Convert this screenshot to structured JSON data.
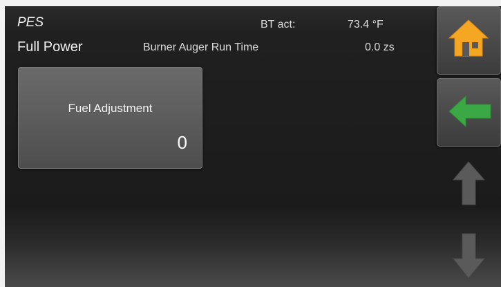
{
  "header": {
    "app_name": "PES",
    "mode": "Full Power"
  },
  "readings": {
    "bt_label": "BT act:",
    "bt_value": "73.4 °F",
    "auger_label": "Burner Auger Run Time",
    "auger_value": "0.0 zs"
  },
  "tile": {
    "label": "Fuel Adjustment",
    "value": "0"
  },
  "nav": {
    "home_icon": "home-icon",
    "back_icon": "back-arrow-icon",
    "up_icon": "up-arrow-icon",
    "down_icon": "down-arrow-icon"
  },
  "colors": {
    "home_icon": "#f5a623",
    "back_icon": "#3aa845",
    "disabled_arrow": "#5a5a5a"
  }
}
